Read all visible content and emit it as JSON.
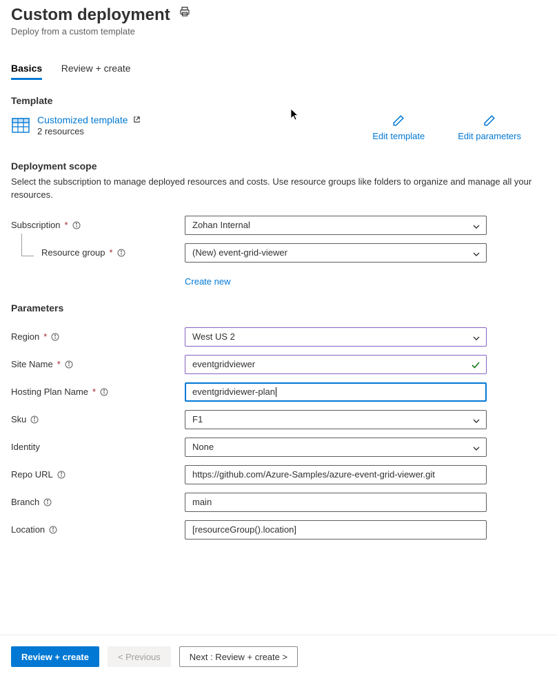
{
  "header": {
    "title": "Custom deployment",
    "subtitle": "Deploy from a custom template"
  },
  "tabs": [
    {
      "label": "Basics",
      "active": true
    },
    {
      "label": "Review + create",
      "active": false
    }
  ],
  "template_section": {
    "title": "Template",
    "link_label": "Customized template",
    "resource_count": "2 resources",
    "edit_template": "Edit template",
    "edit_parameters": "Edit parameters"
  },
  "scope": {
    "title": "Deployment scope",
    "description": "Select the subscription to manage deployed resources and costs. Use resource groups like folders to organize and manage all your resources.",
    "subscription_label": "Subscription",
    "subscription_value": "Zohan Internal",
    "resource_group_label": "Resource group",
    "resource_group_value": "(New) event-grid-viewer",
    "create_new": "Create new"
  },
  "parameters": {
    "title": "Parameters",
    "region_label": "Region",
    "region_value": "West US 2",
    "site_name_label": "Site Name",
    "site_name_value": "eventgridviewer",
    "hosting_plan_label": "Hosting Plan Name",
    "hosting_plan_value": "eventgridviewer-plan",
    "sku_label": "Sku",
    "sku_value": "F1",
    "identity_label": "Identity",
    "identity_value": "None",
    "repo_url_label": "Repo URL",
    "repo_url_value": "https://github.com/Azure-Samples/azure-event-grid-viewer.git",
    "branch_label": "Branch",
    "branch_value": "main",
    "location_label": "Location",
    "location_value": "[resourceGroup().location]"
  },
  "footer": {
    "review_create": "Review + create",
    "previous": "< Previous",
    "next": "Next : Review + create >"
  }
}
